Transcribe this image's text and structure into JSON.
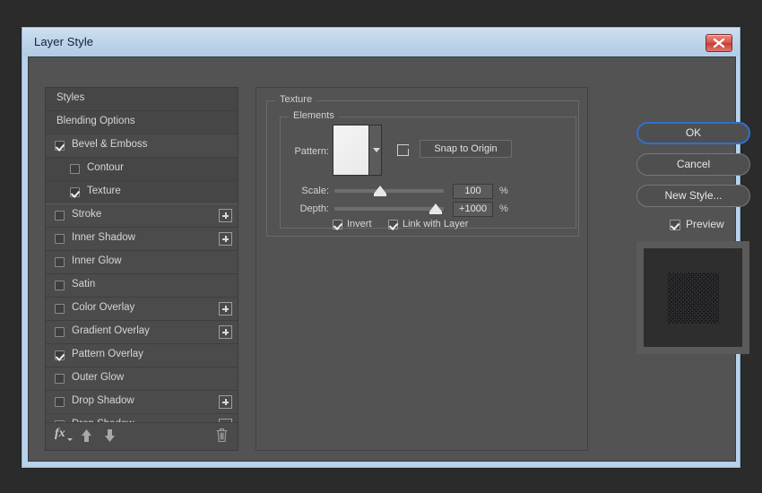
{
  "window": {
    "title": "Layer Style",
    "close_icon": "close-icon"
  },
  "styles_list": {
    "items": [
      {
        "label": "Styles",
        "checkbox": null,
        "selected": false,
        "indent": false,
        "plus": false
      },
      {
        "label": "Blending Options",
        "checkbox": null,
        "selected": false,
        "indent": false,
        "plus": false
      },
      {
        "label": "Bevel & Emboss",
        "checkbox": true,
        "selected": false,
        "indent": false,
        "plus": false
      },
      {
        "label": "Contour",
        "checkbox": false,
        "selected": false,
        "indent": true,
        "plus": false
      },
      {
        "label": "Texture",
        "checkbox": true,
        "selected": true,
        "indent": true,
        "plus": false
      },
      {
        "label": "Stroke",
        "checkbox": false,
        "selected": false,
        "indent": false,
        "plus": true
      },
      {
        "label": "Inner Shadow",
        "checkbox": false,
        "selected": false,
        "indent": false,
        "plus": true
      },
      {
        "label": "Inner Glow",
        "checkbox": false,
        "selected": false,
        "indent": false,
        "plus": false
      },
      {
        "label": "Satin",
        "checkbox": false,
        "selected": false,
        "indent": false,
        "plus": false
      },
      {
        "label": "Color Overlay",
        "checkbox": false,
        "selected": false,
        "indent": false,
        "plus": true
      },
      {
        "label": "Gradient Overlay",
        "checkbox": false,
        "selected": false,
        "indent": false,
        "plus": true
      },
      {
        "label": "Pattern Overlay",
        "checkbox": true,
        "selected": false,
        "indent": false,
        "plus": false
      },
      {
        "label": "Outer Glow",
        "checkbox": false,
        "selected": false,
        "indent": false,
        "plus": false
      },
      {
        "label": "Drop Shadow",
        "checkbox": false,
        "selected": false,
        "indent": false,
        "plus": true
      },
      {
        "label": "Drop Shadow",
        "checkbox": false,
        "selected": false,
        "indent": false,
        "plus": true
      }
    ],
    "toolbar": {
      "fx_label": "fx",
      "fx_icon": "fx-icon",
      "move_up_icon": "arrow-up-icon",
      "move_down_icon": "arrow-down-icon",
      "delete_icon": "trash-icon"
    }
  },
  "texture_panel": {
    "group_title": "Texture",
    "elements_title": "Elements",
    "pattern": {
      "label": "Pattern:",
      "swatch_icon": "pattern-swatch",
      "dropdown_icon": "chevron-down-icon",
      "new_preset_icon": "new-preset-icon",
      "snap_button": "Snap to Origin"
    },
    "scale": {
      "label": "Scale:",
      "value": "100",
      "unit": "%",
      "slider_percent": 42
    },
    "depth": {
      "label": "Depth:",
      "value": "+1000",
      "unit": "%",
      "slider_percent": 93
    },
    "invert": {
      "label": "Invert",
      "checked": true
    },
    "link_with_layer": {
      "label": "Link with Layer",
      "checked": true
    }
  },
  "actions": {
    "ok": "OK",
    "cancel": "Cancel",
    "new_style": "New Style...",
    "preview": {
      "label": "Preview",
      "checked": true
    }
  },
  "colors": {
    "dialog_bg": "#535353",
    "list_bg": "#4b4b4b",
    "selected_row": "#6e6e6e",
    "titlebar": "#bed5ea",
    "focus_blue": "#2f6fd0",
    "close_red": "#d9554c"
  }
}
